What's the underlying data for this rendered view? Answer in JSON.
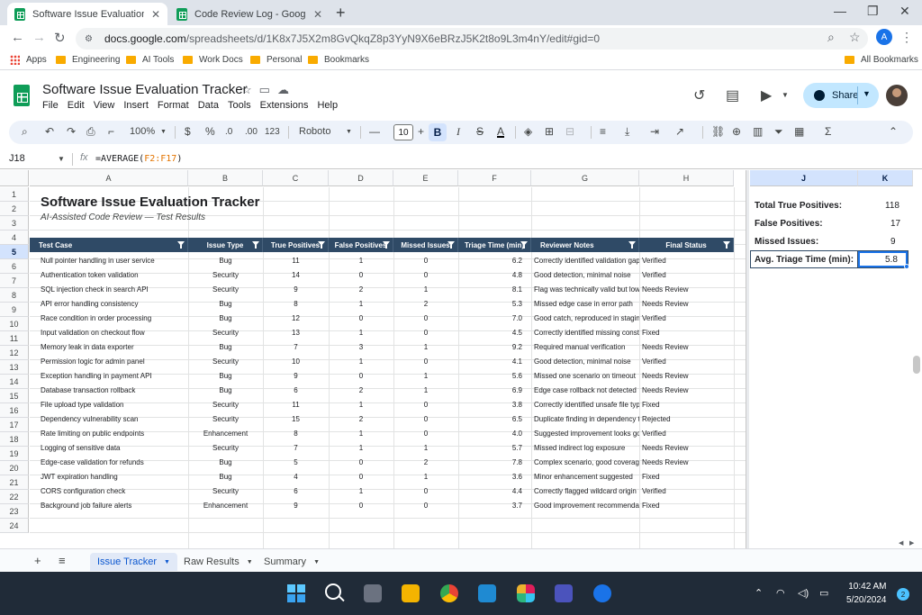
{
  "browser": {
    "tabs": [
      {
        "title": "Software Issue Evaluation Tracker"
      },
      {
        "title": "Code Review Log - Google Sheets"
      }
    ],
    "url_host": "docs.google.com",
    "url_path": "/spreadsheets/d/1K8x7J5X2m8GvQkqZ8p3YyN9X6eBRzJ5K2t8o9L3m4nY/edit#gid=0",
    "profile_initial": "A",
    "bookmarks": [
      "Apps",
      "Engineering",
      "AI Tools",
      "Work Docs",
      "Personal",
      "Bookmarks"
    ],
    "all_bookmarks": "All Bookmarks"
  },
  "sheets": {
    "doc_title": "Software Issue Evaluation Tracker",
    "menu": [
      "File",
      "Edit",
      "View",
      "Insert",
      "Format",
      "Data",
      "Tools",
      "Extensions",
      "Help"
    ],
    "share_label": "Share",
    "toolbar": {
      "zoom": "100%",
      "currency": "$",
      "percent": "%",
      "dec_decrease": ".0",
      "dec_increase": ".00",
      "number_format": "123",
      "font": "Roboto",
      "font_size": "10",
      "bold": "B",
      "italic": "I",
      "strike": "S",
      "text_color": "A"
    },
    "name_box": "J18",
    "fx_label": "fx",
    "formula_prefix": "=AVERAGE(",
    "formula_range": "F2:F17",
    "formula_suffix": ")",
    "columns": [
      "A",
      "B",
      "C",
      "D",
      "E",
      "F",
      "G",
      "H",
      "J",
      "K"
    ],
    "rows": [
      "1",
      "2",
      "3",
      "4",
      "5",
      "6",
      "7",
      "8",
      "9",
      "10",
      "11",
      "12",
      "13",
      "14",
      "15",
      "16",
      "17",
      "18",
      "19",
      "20",
      "21",
      "22",
      "23",
      "24"
    ],
    "title": "Software Issue Evaluation Tracker",
    "subtitle": "AI-Assisted Code Review — Test Results",
    "headers": [
      "Test Case",
      "Issue Type",
      "True Positives",
      "False Positives",
      "Missed Issues",
      "Triage Time (min)",
      "Reviewer Notes",
      "Final Status"
    ],
    "data": [
      [
        "Null pointer handling in user service",
        "Bug",
        "11",
        "1",
        "0",
        "6.2",
        "Correctly identified validation gap",
        "Verified"
      ],
      [
        "Authentication token validation",
        "Security",
        "14",
        "0",
        "0",
        "4.8",
        "Good detection, minimal noise",
        "Verified"
      ],
      [
        "SQL injection check in search API",
        "Security",
        "9",
        "2",
        "1",
        "8.1",
        "Flag was technically valid but low priority",
        "Needs Review"
      ],
      [
        "API error handling consistency",
        "Bug",
        "8",
        "1",
        "2",
        "5.3",
        "Missed edge case in error path",
        "Needs Review"
      ],
      [
        "Race condition in order processing",
        "Bug",
        "12",
        "0",
        "0",
        "7.0",
        "Good catch, reproduced in staging",
        "Verified"
      ],
      [
        "Input validation on checkout flow",
        "Security",
        "13",
        "1",
        "0",
        "4.5",
        "Correctly identified missing constraint",
        "Fixed"
      ],
      [
        "Memory leak in data exporter",
        "Bug",
        "7",
        "3",
        "1",
        "9.2",
        "Required manual verification",
        "Needs Review"
      ],
      [
        "Permission logic for admin panel",
        "Security",
        "10",
        "1",
        "0",
        "4.1",
        "Good detection, minimal noise",
        "Verified"
      ],
      [
        "Exception handling in payment API",
        "Bug",
        "9",
        "0",
        "1",
        "5.6",
        "Missed one scenario on timeout",
        "Needs Review"
      ],
      [
        "Database transaction rollback",
        "Bug",
        "6",
        "2",
        "1",
        "6.9",
        "Edge case rollback not detected",
        "Needs Review"
      ],
      [
        "File upload type validation",
        "Security",
        "11",
        "1",
        "0",
        "3.8",
        "Correctly identified unsafe file type",
        "Fixed"
      ],
      [
        "Dependency vulnerability scan",
        "Security",
        "15",
        "2",
        "0",
        "6.5",
        "Duplicate finding in dependency tree",
        "Rejected"
      ],
      [
        "Rate limiting on public endpoints",
        "Enhancement",
        "8",
        "1",
        "0",
        "4.0",
        "Suggested improvement looks good",
        "Verified"
      ],
      [
        "Logging of sensitive data",
        "Security",
        "7",
        "1",
        "1",
        "5.7",
        "Missed indirect log exposure",
        "Needs Review"
      ],
      [
        "Edge-case validation for refunds",
        "Bug",
        "5",
        "0",
        "2",
        "7.8",
        "Complex scenario, good coverage",
        "Needs Review"
      ],
      [
        "JWT expiration handling",
        "Bug",
        "4",
        "0",
        "1",
        "3.6",
        "Minor enhancement suggested",
        "Fixed"
      ],
      [
        "CORS configuration check",
        "Security",
        "6",
        "1",
        "0",
        "4.4",
        "Correctly flagged wildcard origin",
        "Verified"
      ],
      [
        "Background job failure alerts",
        "Enhancement",
        "9",
        "0",
        "0",
        "3.7",
        "Good improvement recommendation",
        "Fixed"
      ]
    ],
    "summary": [
      {
        "label": "Total True Positives:",
        "value": "118"
      },
      {
        "label": "False Positives:",
        "value": "17"
      },
      {
        "label": "Missed Issues:",
        "value": "9"
      },
      {
        "label": "Avg. Triage Time (min):",
        "value": "5.8"
      }
    ],
    "sheet_tabs": [
      "Issue Tracker",
      "Raw Results",
      "Summary"
    ]
  },
  "taskbar": {
    "time": "10:42 AM",
    "date": "5/20/2024",
    "notifications": "2"
  },
  "colors": {
    "header_fill": "#2f4a66",
    "share_fill": "#c2e7ff",
    "selection": "#1a73e8",
    "sheets_green": "#0f9d58"
  }
}
